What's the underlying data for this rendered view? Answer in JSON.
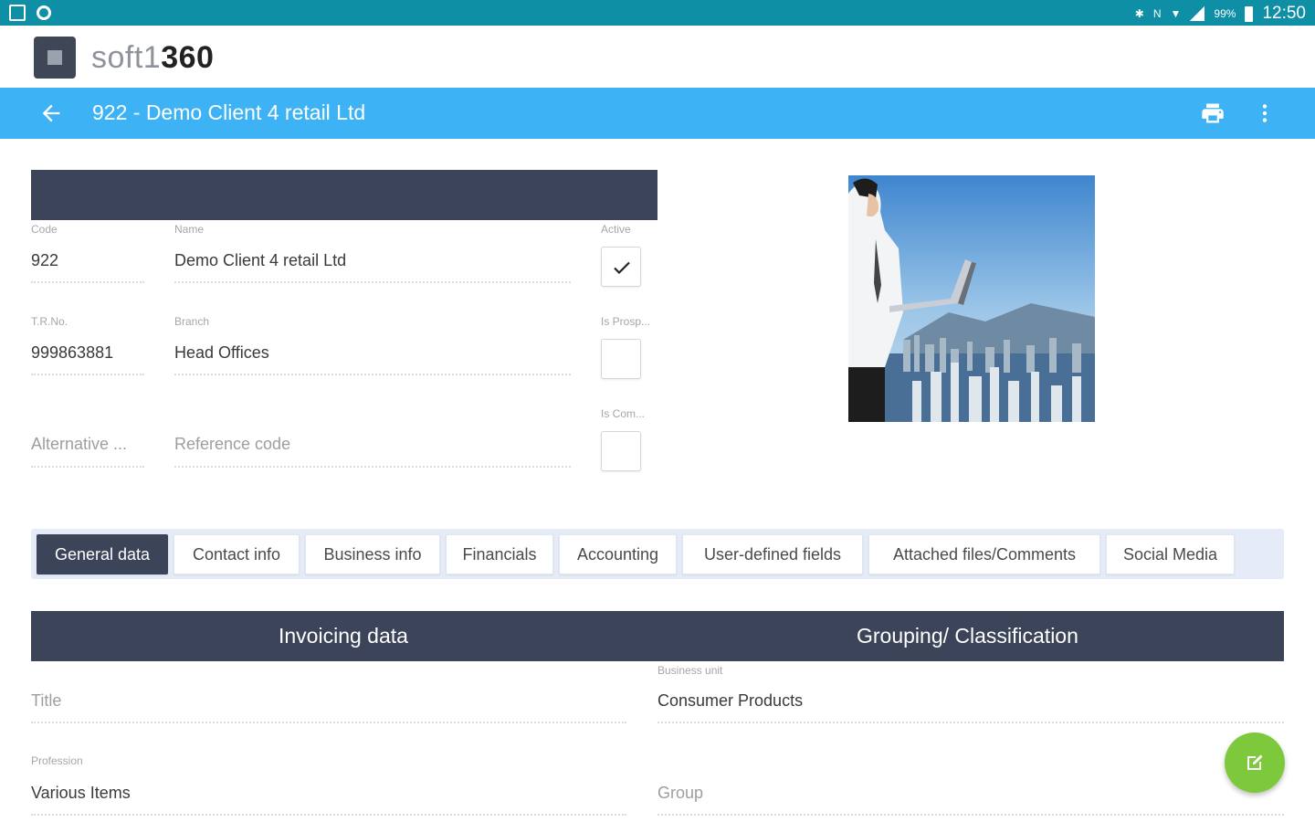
{
  "status_bar": {
    "time": "12:50",
    "battery": "99%",
    "icons": [
      "image-icon",
      "c-app-icon",
      "bluetooth-icon",
      "nfc-icon",
      "wifi-icon",
      "signal-icon",
      "battery-icon"
    ]
  },
  "brand": {
    "name_light": "soft1",
    "name_bold": "360"
  },
  "appbar": {
    "title": "922 - Demo Client 4 retail Ltd"
  },
  "form": {
    "code": {
      "label": "Code",
      "value": "922"
    },
    "name": {
      "label": "Name",
      "value": "Demo Client 4 retail Ltd"
    },
    "active": {
      "label": "Active",
      "checked": true
    },
    "tr_no": {
      "label": "T.R.No.",
      "value": "999863881"
    },
    "branch": {
      "label": "Branch",
      "value": "Head Offices"
    },
    "is_prospect": {
      "label": "Is Prosp...",
      "checked": false
    },
    "alternative": {
      "placeholder": "Alternative ..."
    },
    "reference_code": {
      "placeholder": "Reference code"
    },
    "is_com": {
      "label": "Is Com...",
      "checked": false
    }
  },
  "tabs": [
    {
      "label": "General data",
      "active": true
    },
    {
      "label": "Contact info",
      "active": false
    },
    {
      "label": "Business info",
      "active": false
    },
    {
      "label": "Financials",
      "active": false
    },
    {
      "label": "Accounting",
      "active": false
    },
    {
      "label": "User-defined fields",
      "active": false
    },
    {
      "label": "Attached files/Comments",
      "active": false
    },
    {
      "label": "Social Media",
      "active": false
    }
  ],
  "section": {
    "left_title": "Invoicing data",
    "right_title": "Grouping/ Classification"
  },
  "invoicing": {
    "title": {
      "placeholder": "Title"
    },
    "profession": {
      "label": "Profession",
      "value": "Various Items"
    }
  },
  "grouping": {
    "business_unit": {
      "label": "Business unit",
      "value": "Consumer Products"
    },
    "group": {
      "placeholder": "Group"
    }
  },
  "colors": {
    "status_bar": "#0f8fa6",
    "appbar": "#3db3f5",
    "dark_header": "#3b4458",
    "fab": "#7ec93b"
  }
}
